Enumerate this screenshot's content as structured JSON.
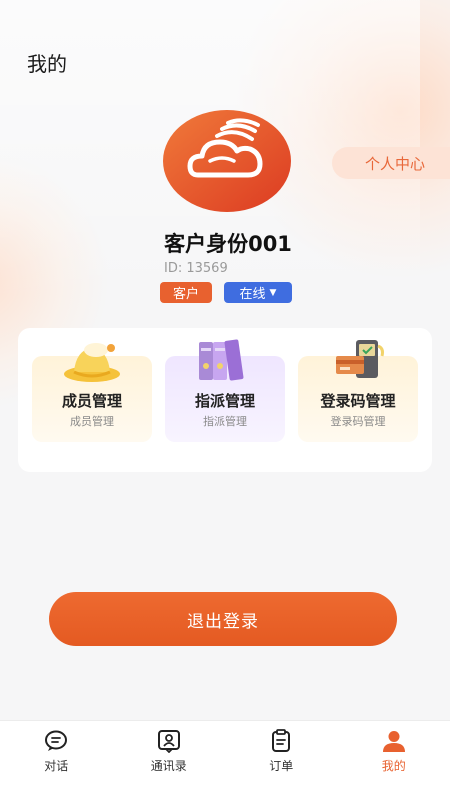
{
  "header": {
    "title": "我的"
  },
  "profile": {
    "center_button": "个人中心",
    "name": "客户身份001",
    "id_text": "ID: 13569",
    "role_tag": "客户",
    "status_tag": "在线",
    "status_caret": "▼"
  },
  "features": [
    {
      "title": "成员管理",
      "subtitle": "成员管理",
      "icon": "hat-icon"
    },
    {
      "title": "指派管理",
      "subtitle": "指派管理",
      "icon": "folders-icon"
    },
    {
      "title": "登录码管理",
      "subtitle": "登录码管理",
      "icon": "card-terminal-icon"
    }
  ],
  "logout_label": "退出登录",
  "tabs": [
    {
      "label": "对话",
      "icon": "chat-icon",
      "active": false
    },
    {
      "label": "通讯录",
      "icon": "contacts-icon",
      "active": false
    },
    {
      "label": "订单",
      "icon": "order-icon",
      "active": false
    },
    {
      "label": "我的",
      "icon": "person-icon",
      "active": true
    }
  ],
  "colors": {
    "accent": "#e8612f",
    "status_blue": "#3f6de0",
    "center_button_bg": "#fde3d6"
  }
}
